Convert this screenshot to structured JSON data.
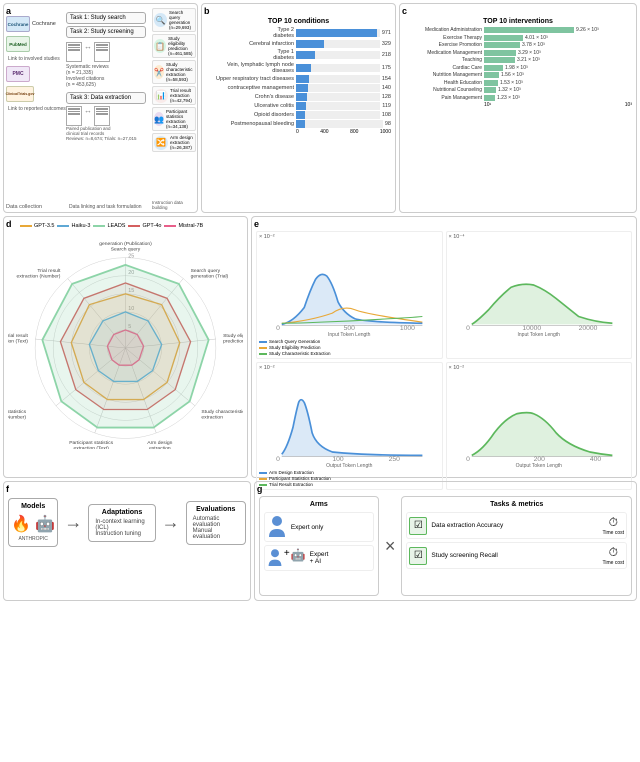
{
  "sections": {
    "a_label": "a",
    "b_label": "b",
    "c_label": "c",
    "d_label": "d",
    "e_label": "e",
    "f_label": "f",
    "g_label": "g"
  },
  "panel_a": {
    "data_collection_label": "Data collection",
    "data_linking_label": "Data linking and task formulation",
    "instruction_building_label": "Instruction data building",
    "databases": [
      {
        "name": "Cochrane",
        "color": "#d4e8f7",
        "text_color": "#1a5276"
      },
      {
        "name": "PubMed.gov",
        "color": "#e8f5e8",
        "text_color": "#1a5e20"
      },
      {
        "name": "PMC",
        "color": "#f0e8f7",
        "text_color": "#5b2c6f"
      },
      {
        "name": "ClinicalTrials.gov",
        "color": "#fff3e0",
        "text_color": "#784212"
      }
    ],
    "link_labels": [
      "Link to involved studies",
      "Link to reported outcomes"
    ],
    "tasks": [
      {
        "label": "Task 1: Study search"
      },
      {
        "label": "Task 2: Study screening"
      },
      {
        "label": "Task 3: Data extraction"
      }
    ],
    "stats": [
      "Systematic reviews (n = 21,335)",
      "Involved citations (n = 453,625)",
      "Paired publication and clinical trial records (Reviews: n = 8,674; Trials: n = 27,015)"
    ],
    "right_tasks": [
      {
        "label": "Search query generation (n = 29,693)",
        "icon": "🔍",
        "bg": "#d4e8f7"
      },
      {
        "label": "Study eligibility prediction (n = 461,585)",
        "icon": "📋",
        "bg": "#d5f5e3"
      },
      {
        "label": "Study characteristic extraction (n = 58,593)",
        "icon": "✂️",
        "bg": "#fdebd0"
      },
      {
        "label": "Trial result extraction (n = 42,794)",
        "icon": "📊",
        "bg": "#f9ebea"
      },
      {
        "label": "Participant statistics extraction (n = 34,138)",
        "icon": "👥",
        "bg": "#e8daef"
      },
      {
        "label": "Arm design extraction (n = 26,387)",
        "icon": "🔀",
        "bg": "#d6eaf8"
      }
    ]
  },
  "panel_b": {
    "title": "TOP 10 conditions",
    "bars": [
      {
        "label": "Type 2 diabetes",
        "value": 971,
        "max": 971
      },
      {
        "label": "Cerebral infarction",
        "value": 329,
        "max": 971
      },
      {
        "label": "Type 1 diabetes",
        "value": 218,
        "max": 971
      },
      {
        "label": "Vein, lymphatic lymph node diseases",
        "value": 175,
        "max": 971
      },
      {
        "label": "Upper respiratory tract diseases",
        "value": 154,
        "max": 971
      },
      {
        "label": "contraceptive management",
        "value": 140,
        "max": 971
      },
      {
        "label": "Crohn's disease",
        "value": 128,
        "max": 971
      },
      {
        "label": "Ulcerative colitis",
        "value": 119,
        "max": 971
      },
      {
        "label": "Opioid disorders",
        "value": 108,
        "max": 971
      },
      {
        "label": "Postmenopausal bleeding",
        "value": 98,
        "max": 971
      }
    ],
    "axis_labels": [
      "0",
      "400",
      "800",
      "1000"
    ]
  },
  "panel_c": {
    "title": "TOP 10 interventions",
    "bars": [
      {
        "label": "Medication Administration",
        "value": 9.26,
        "display": "9.26 × 10³"
      },
      {
        "label": "Exercise Therapy",
        "value": 4.01,
        "display": "4.01 × 10³"
      },
      {
        "label": "Exercise Promotion",
        "value": 3.78,
        "display": "3.78 × 10³"
      },
      {
        "label": "Medication Management",
        "value": 3.29,
        "display": "3.29 × 10³"
      },
      {
        "label": "Teaching",
        "value": 3.21,
        "display": "3.21 × 10³"
      },
      {
        "label": "Cardiac Care",
        "value": 1.98,
        "display": "1.98 × 10³"
      },
      {
        "label": "Nutrition Management",
        "value": 1.56,
        "display": "1.56 × 10³"
      },
      {
        "label": "Health Education",
        "value": 1.53,
        "display": "1.53 × 10³"
      },
      {
        "label": "Nutritional Counseling",
        "value": 1.32,
        "display": "1.32 × 10³"
      },
      {
        "label": "Pain Management",
        "value": 1.23,
        "display": "1.23 × 10³"
      }
    ]
  },
  "panel_d": {
    "legend": [
      {
        "label": "GPT-3.5",
        "color": "#e8a838"
      },
      {
        "label": "GPT-4o",
        "color": "#d45f5f"
      },
      {
        "label": "Haiku-3",
        "color": "#5fa8d4"
      },
      {
        "label": "Mistral-7B",
        "color": "#e85f8a"
      },
      {
        "label": "LEADS",
        "color": "#8dd4a8"
      }
    ],
    "axes": [
      "Search query generation (Publication)",
      "Search query generation (Trial)",
      "Study eligibility prediction",
      "Study characteristic extraction",
      "Arm design extraction",
      "Participant statistics extraction (Text)",
      "Participant statistics extraction (Number)",
      "Trial result extraction (Text)",
      "Trial result extraction (Number)"
    ],
    "max_value": 25
  },
  "panel_e": {
    "charts": [
      {
        "title": "× 10⁻²",
        "x_label": "Input Token Length",
        "x_max": "1000",
        "legend": [
          "Search Query Generation",
          "Study Eligibility Prediction",
          "Study Characteristic Extraction"
        ]
      },
      {
        "title": "× 10⁻⁴",
        "x_label": "Input Token Length",
        "x_max": "20000",
        "legend": [
          "Search Query Generation",
          "Study Eligibility Prediction",
          "Study Characteristic Extraction"
        ]
      },
      {
        "title": "× 10⁻²",
        "x_label": "Output Token Length",
        "x_max": "250",
        "legend": [
          "Arm Design Extraction",
          "Participant Statistics Extraction",
          "Trial Result Extraction"
        ]
      },
      {
        "title": "× 10⁻²",
        "x_label": "Output Token Length",
        "x_max": "400",
        "legend": [
          "Arm Design Extraction",
          "Participant Statistics Extraction",
          "Trial Result Extraction"
        ]
      }
    ]
  },
  "panel_f": {
    "models_label": "Models",
    "adaptations_label": "Adaptations",
    "evaluations_label": "Evaluations",
    "adaptation_items": [
      "In-context learning (ICL)",
      "Instruction tuning"
    ],
    "evaluation_items": [
      "Automatic evaluation",
      "Manual evaluation"
    ],
    "logos": [
      "🔥",
      "🤖"
    ]
  },
  "panel_g": {
    "arms_title": "Arms",
    "tasks_title": "Tasks & metrics",
    "arm_items": [
      {
        "icon": "👨‍⚕️",
        "text": "Expert only"
      },
      {
        "icon": "👨‍⚕️",
        "text": "Expert + AI"
      }
    ],
    "task_items": [
      {
        "text": "Data extraction Accuracy"
      },
      {
        "text": "Study screening Recall"
      }
    ],
    "multiply_symbol": "×",
    "time_label": "Time cost"
  }
}
